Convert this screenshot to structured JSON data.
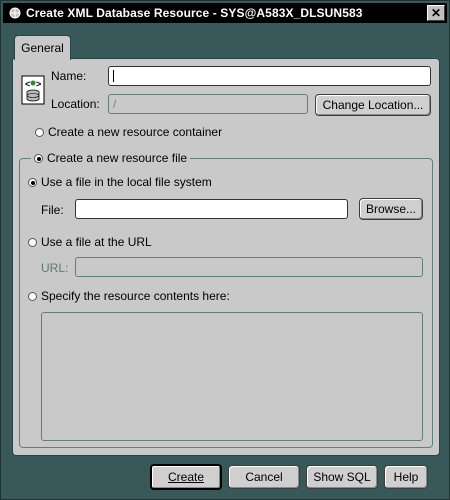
{
  "window": {
    "title": "Create XML Database Resource - SYS@A583X_DLSUN583",
    "close_glyph": "✕"
  },
  "tabs": [
    {
      "label": "General",
      "selected": true
    }
  ],
  "form": {
    "name_label": "Name:",
    "name_value": "",
    "location_label": "Location:",
    "location_value": "/",
    "change_location_button": "Change Location...",
    "new_container_option": "Create a new resource container",
    "new_file_option": "Create a new resource file",
    "local_file_option": "Use a file in the local file system",
    "file_label": "File:",
    "file_value": "",
    "browse_button": "Browse...",
    "url_option": "Use a file at the URL",
    "url_label": "URL:",
    "url_value": "",
    "contents_option": "Specify the resource contents here:",
    "contents_value": ""
  },
  "selection": {
    "resource_type": "new_file",
    "file_source": "local_file"
  },
  "buttons": {
    "create": "Create",
    "cancel": "Cancel",
    "show_sql": "Show SQL",
    "help": "Help"
  },
  "colors": {
    "frame": "#39585a",
    "panel": "#c9c9c9",
    "titlebar": "#000000",
    "disabled_text": "#5a7a7a"
  },
  "icons": {
    "app": "oracle-db-icon",
    "resource": "xml-resource-icon"
  }
}
